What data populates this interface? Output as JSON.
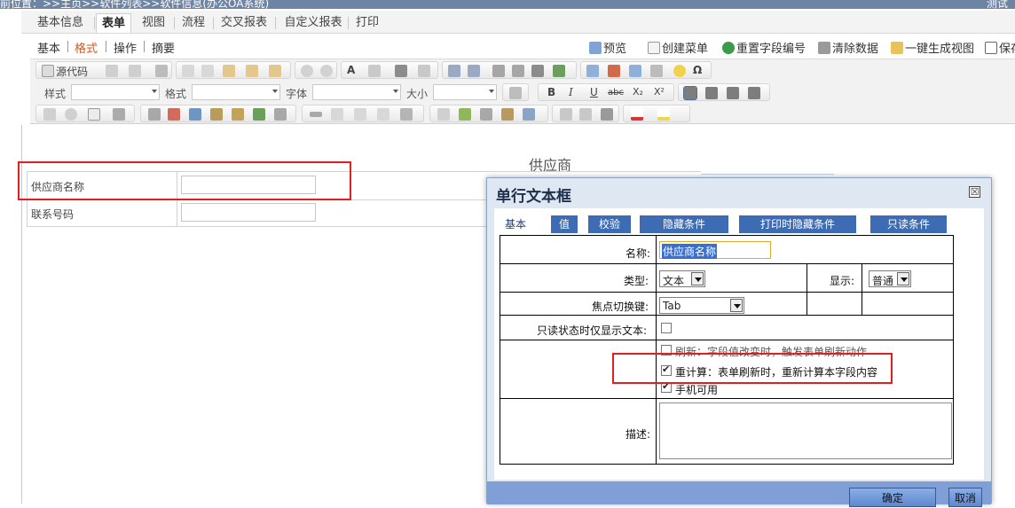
{
  "titlebar": {
    "breadcrumb": "前位置：>>主页>>软件列表>>软件信息(办公OA系统)",
    "right_text": "测试"
  },
  "main_tabs": [
    {
      "label": "基本信息"
    },
    {
      "label": "表单"
    },
    {
      "label": "视图"
    },
    {
      "label": "流程"
    },
    {
      "label": "交叉报表"
    },
    {
      "label": "自定义报表"
    },
    {
      "label": "打印"
    }
  ],
  "sub_tabs": [
    {
      "label": "基本"
    },
    {
      "label": "格式"
    },
    {
      "label": "操作"
    },
    {
      "label": "摘要"
    }
  ],
  "actions": [
    {
      "label": "预览",
      "icon": "preview-icon"
    },
    {
      "label": "创建菜单",
      "icon": "menu-icon"
    },
    {
      "label": "重置字段编号",
      "icon": "refresh-icon"
    },
    {
      "label": "清除数据",
      "icon": "trash-icon"
    },
    {
      "label": "一键生成视图",
      "icon": "wand-icon"
    },
    {
      "label": "保存",
      "icon": "save-icon"
    }
  ],
  "toolbar": {
    "source_label": "源代码",
    "style_label": "样式",
    "format_label": "格式",
    "font_label": "字体",
    "size_label": "大小",
    "bold": "B",
    "italic": "I",
    "underline": "U",
    "strike": "abc",
    "subscript": "X₂",
    "superscript": "X²",
    "find": "A",
    "omega": "Ω"
  },
  "form": {
    "title": "供应商",
    "rows": [
      {
        "label": "供应商名称"
      },
      {
        "label": "联系号码"
      }
    ]
  },
  "dialog": {
    "title": "单行文本框",
    "close": "☒",
    "tabs": [
      {
        "label": "基本"
      },
      {
        "label": "值"
      },
      {
        "label": "校验"
      },
      {
        "label": "隐藏条件"
      },
      {
        "label": "打印时隐藏条件"
      },
      {
        "label": "只读条件"
      }
    ],
    "name_label": "名称:",
    "name_value": "供应商名称",
    "type_label": "类型:",
    "type_value": "文本",
    "display_label": "显示:",
    "display_value": "普通",
    "focus_label": "焦点切换键:",
    "focus_value": "Tab",
    "readonly_label": "只读状态时仅显示文本:",
    "options": [
      {
        "label": "刷新：字段值改变时，触发表单刷新动作",
        "checked": false
      },
      {
        "label": "重计算：表单刷新时，重新计算本字段内容",
        "checked": true
      },
      {
        "label": "手机可用",
        "checked": true
      }
    ],
    "desc_label": "描述:",
    "ok_label": "确定",
    "cancel_label": "取消"
  },
  "colors": {
    "highlight": "#e0201f",
    "dialog_tab": "#3d6cb5",
    "active_subtab": "#d9541e"
  }
}
